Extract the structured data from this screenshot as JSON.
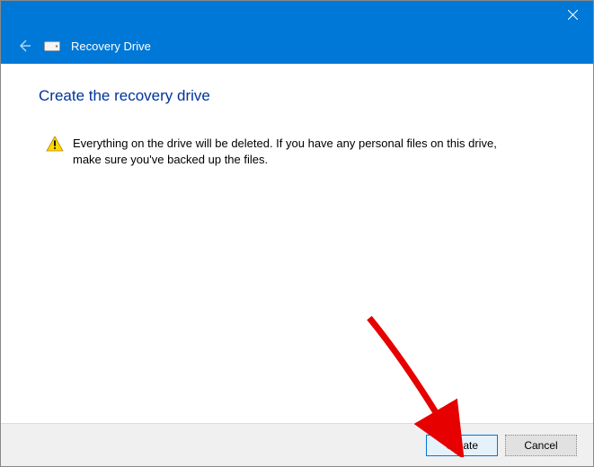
{
  "titlebar": {
    "close_label": "Close"
  },
  "header": {
    "title": "Recovery Drive"
  },
  "content": {
    "page_title": "Create the recovery drive",
    "warning_text": "Everything on the drive will be deleted. If you have any personal files on this drive, make sure you've backed up the files."
  },
  "footer": {
    "create_label": "Create",
    "cancel_label": "Cancel"
  }
}
